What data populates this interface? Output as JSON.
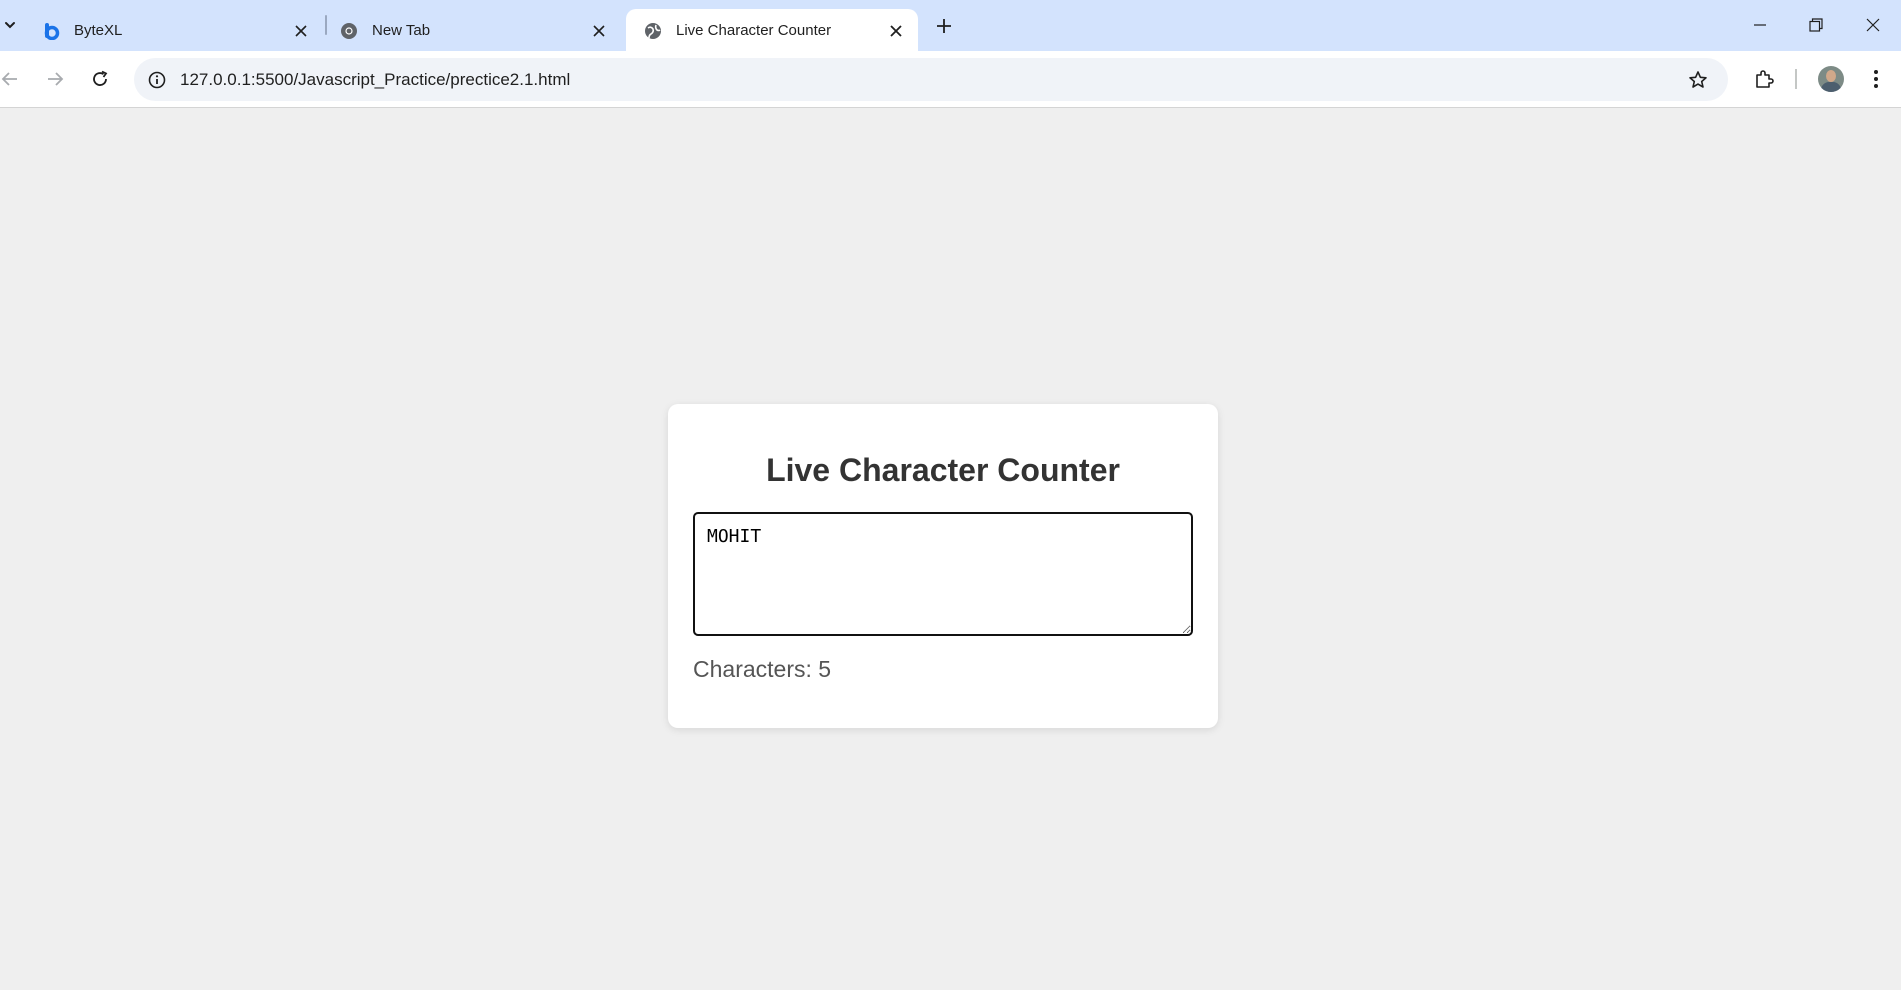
{
  "browser": {
    "tabs": [
      {
        "title": "ByteXL",
        "favicon": "bytexl-logo-icon",
        "active": false
      },
      {
        "title": "New Tab",
        "favicon": "chrome-icon",
        "active": false
      },
      {
        "title": "Live Character Counter",
        "favicon": "globe-icon",
        "active": true
      }
    ],
    "url": "127.0.0.1:5500/Javascript_Practice/prectice2.1.html",
    "colors": {
      "tabstrip": "#d3e3fd",
      "accent": "#1a73e8"
    }
  },
  "page": {
    "heading": "Live Character Counter",
    "textarea_value": "MOHIT",
    "counter_label": "Characters: 5"
  }
}
